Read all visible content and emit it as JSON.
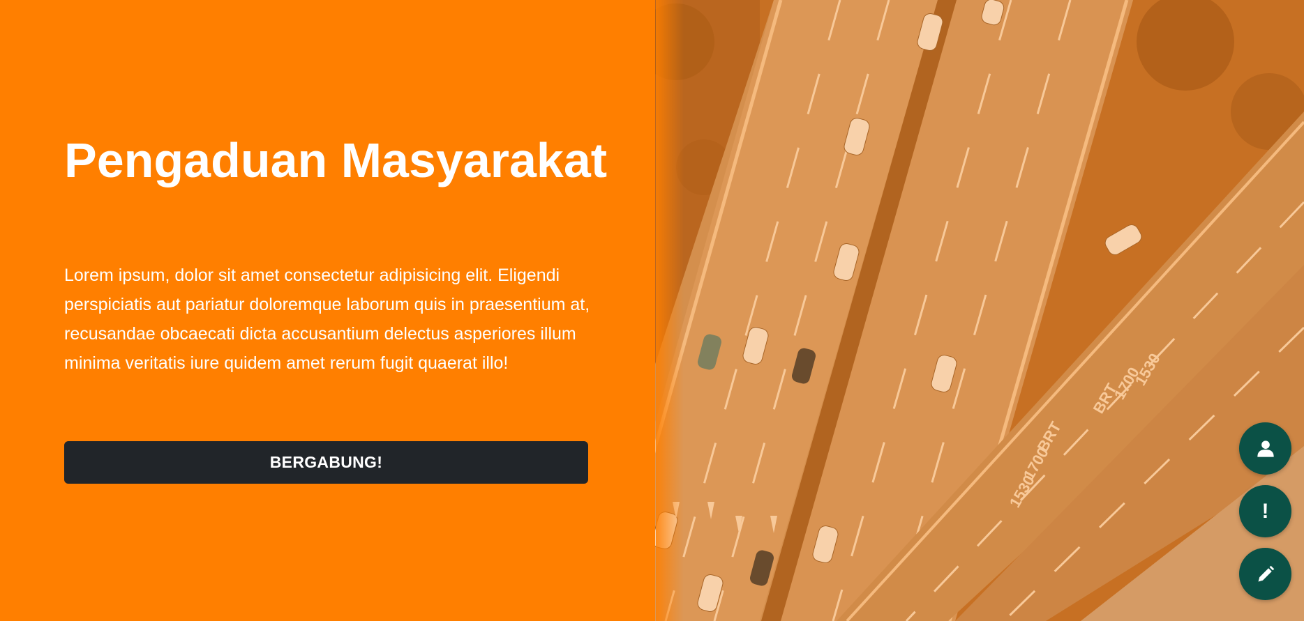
{
  "hero": {
    "title": "Pengaduan Masyarakat",
    "description": "Lorem ipsum, dolor sit amet consectetur adipisicing elit. Eligendi perspiciatis aut pariatur doloremque laborum quis in praesentium at, recusandae obcaecati dicta accusantium delectus asperiores illum minima veritatis iure quidem amet rerum fugit quaerat illo!",
    "button_label": "BERGABUNG!"
  },
  "road_markings": {
    "upper": [
      "1530",
      "1700",
      "BRT"
    ],
    "lower": [
      "BRT",
      "1700",
      "1530"
    ]
  },
  "fab": {
    "user_icon": "user-icon",
    "alert_label": "!",
    "edit_icon": "pencil-icon"
  },
  "colors": {
    "brand_orange": "#ff7f00",
    "button_dark": "#212529",
    "fab_green": "#0b5146",
    "overlay_orange": "#e8893a"
  }
}
